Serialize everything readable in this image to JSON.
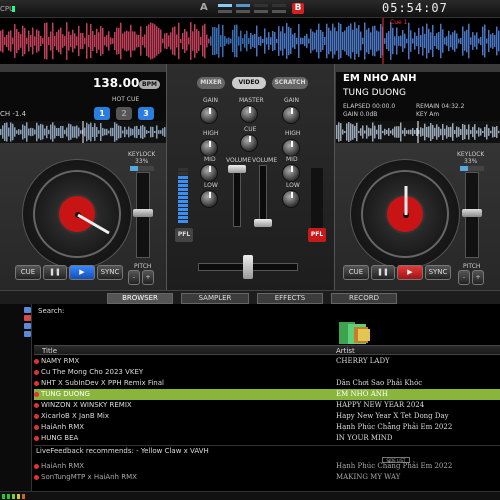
{
  "app": {
    "cpu_label": "CPU",
    "side_a": "A",
    "side_b": "B",
    "clock": "05:54:07",
    "cue_marker": "Cue 1"
  },
  "left_deck": {
    "bpm": "138.00",
    "bpm_badge": "BPM",
    "pitch_label": "CH -1.4",
    "hot_cue_label": "HOT CUE",
    "hot_cues": [
      "1",
      "2",
      "3"
    ],
    "keylock_label": "KEYLOCK",
    "keylock_value": "33%",
    "keylock_fraction": 0.33,
    "cue_button": "CUE",
    "pause_button": "❚❚",
    "play_button": "▶",
    "sync_button": "SYNC",
    "pitch_slider_label": "PITCH",
    "accent": "#3a86ff"
  },
  "right_deck": {
    "title": "EM NHO ANH",
    "artist": "TUNG DUONG",
    "elapsed": "ELAPSED 00:00.0",
    "remain": "REMAIN 04:32.2",
    "gain": "GAIN 0.0dB",
    "key": "KEY Am",
    "keylock_label": "KEYLOCK",
    "keylock_value": "33%",
    "keylock_fraction": 0.33,
    "cue_button": "CUE",
    "pause_button": "❚❚",
    "play_button": "▶",
    "sync_button": "SYNC",
    "pitch_slider_label": "PITCH",
    "accent": "#e23a3a"
  },
  "mixer": {
    "tabs": [
      "MIXER",
      "VIDEO",
      "SCRATCH"
    ],
    "active_tab": "VIDEO",
    "gain_left": "GAIN",
    "gain_right": "GAIN",
    "master": "MASTER",
    "cue": "CUE",
    "high_left": "HIGH",
    "high_right": "HIGH",
    "mid_left": "MID",
    "mid_right": "MID",
    "low_left": "LOW",
    "low_right": "LOW",
    "volume_left": "VOLUME",
    "volume_right": "VOLUME",
    "pfl_left": "PFL",
    "pfl_right": "PFL"
  },
  "browser": {
    "tabs": [
      "BROWSER",
      "SAMPLER",
      "EFFECTS",
      "RECORD"
    ],
    "active_tab": "BROWSER",
    "search_label": "Search:",
    "search_value": "",
    "columns": {
      "title": "Title",
      "artist": "Artist"
    },
    "rows": [
      {
        "title": "NAMY RMX",
        "artist": "CHERRY LADY"
      },
      {
        "title": "Cu The Mong Cho 2023 VKEY",
        "artist": ""
      },
      {
        "title": "NHT X SubInDev X PPH Remix Final",
        "artist": "Dân Chơi Sao Phải Khóc"
      },
      {
        "title": "TUNG DUONG",
        "artist": "EM NHO ANH"
      },
      {
        "title": "WINZON X WINSKY REMIX",
        "artist": "HAPPY NEW YEAR 2024"
      },
      {
        "title": "XicarloB X JanB Mix",
        "artist": "Hapy New Year X Tet Dong Day"
      },
      {
        "title": "HaiAnh RMX",
        "artist": "Hạnh Phúc Chẳng Phải Em 2022"
      },
      {
        "title": "HUNG BEA",
        "artist": "IN YOUR MIND"
      }
    ],
    "selected_row": 3,
    "livefeedback": "LiveFeedback recommends:  - Yellow Claw x VAVH",
    "side_list": "SIDE LIST",
    "rec_rows": [
      {
        "title": "HaiAnh RMX",
        "artist": "Hạnh Phúc Chẳng Phải Em 2022"
      },
      {
        "title": "SonTungMTP x HaiAnh RMX",
        "artist": "MAKING MY WAY"
      }
    ]
  }
}
